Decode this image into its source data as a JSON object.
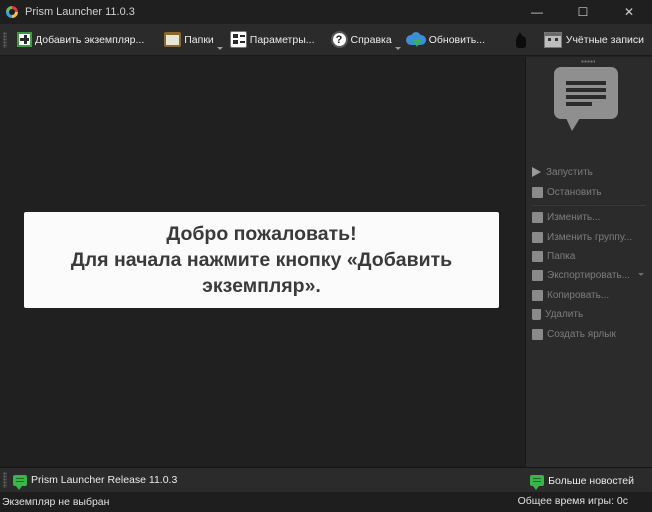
{
  "window": {
    "title": "Prism Launcher 11.0.3",
    "minimize_glyph": "—",
    "maximize_glyph": "☐",
    "close_glyph": "✕"
  },
  "toolbar": {
    "add_instance": "Добавить экземпляр...",
    "folders": "Папки",
    "settings": "Параметры...",
    "help": "Справка",
    "update": "Обновить...",
    "accounts": "Учётные записи",
    "help_glyph": "?"
  },
  "welcome": {
    "line1": "Добро пожаловать!",
    "line2": "Для начала нажмите кнопку «Добавить",
    "line3": "экземпляр»."
  },
  "side_panel": {
    "launch": "Запустить",
    "kill": "Остановить",
    "edit": "Изменить...",
    "change_group": "Изменить группу...",
    "folder": "Папка",
    "export": "Экспортировать...",
    "copy": "Копировать...",
    "delete": "Удалить",
    "create_shortcut": "Создать ярлык"
  },
  "bottom_bar": {
    "news": "Prism Launcher Release 11.0.3",
    "more_news": "Больше новостей"
  },
  "status_bar": {
    "instance": "Экземпляр не выбран",
    "playtime": "Общее время игры: 0с"
  },
  "colors": {
    "background": "#202020",
    "panel": "#2b2b2b",
    "accent_green": "#3ab54a",
    "accent_blue": "#3a8fd8",
    "disabled_text": "#7d7d7d"
  }
}
